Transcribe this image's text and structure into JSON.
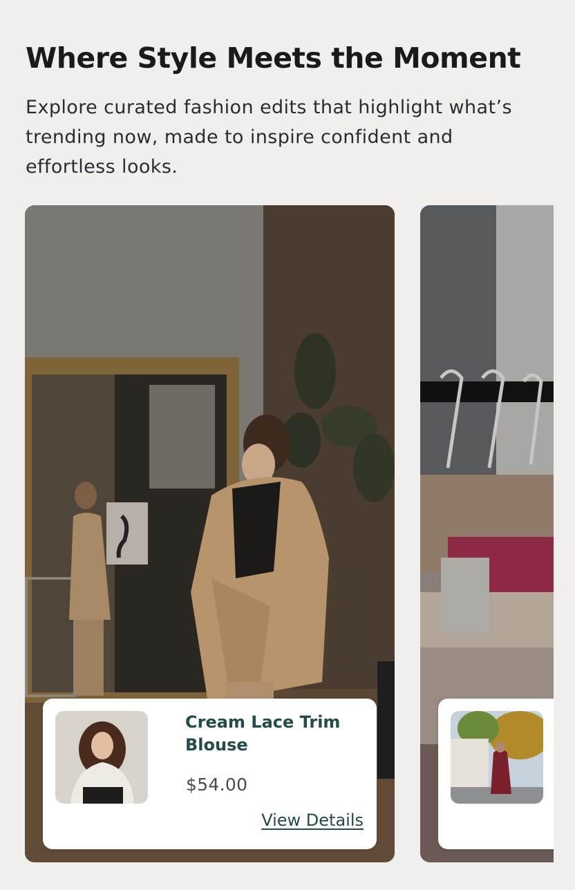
{
  "section": {
    "title": "Where Style Meets the Moment",
    "description": "Explore curated fashion edits that highlight what’s trending now, made to inspire confident and effortless looks."
  },
  "slides": [
    {
      "product": {
        "name": "Cream Lace Trim Blouse",
        "price": "$54.00",
        "link_label": "View Details"
      }
    },
    {
      "product": {}
    }
  ],
  "colors": {
    "background": "#f0efed",
    "product_name": "#234b4b",
    "card": "#ffffff"
  }
}
